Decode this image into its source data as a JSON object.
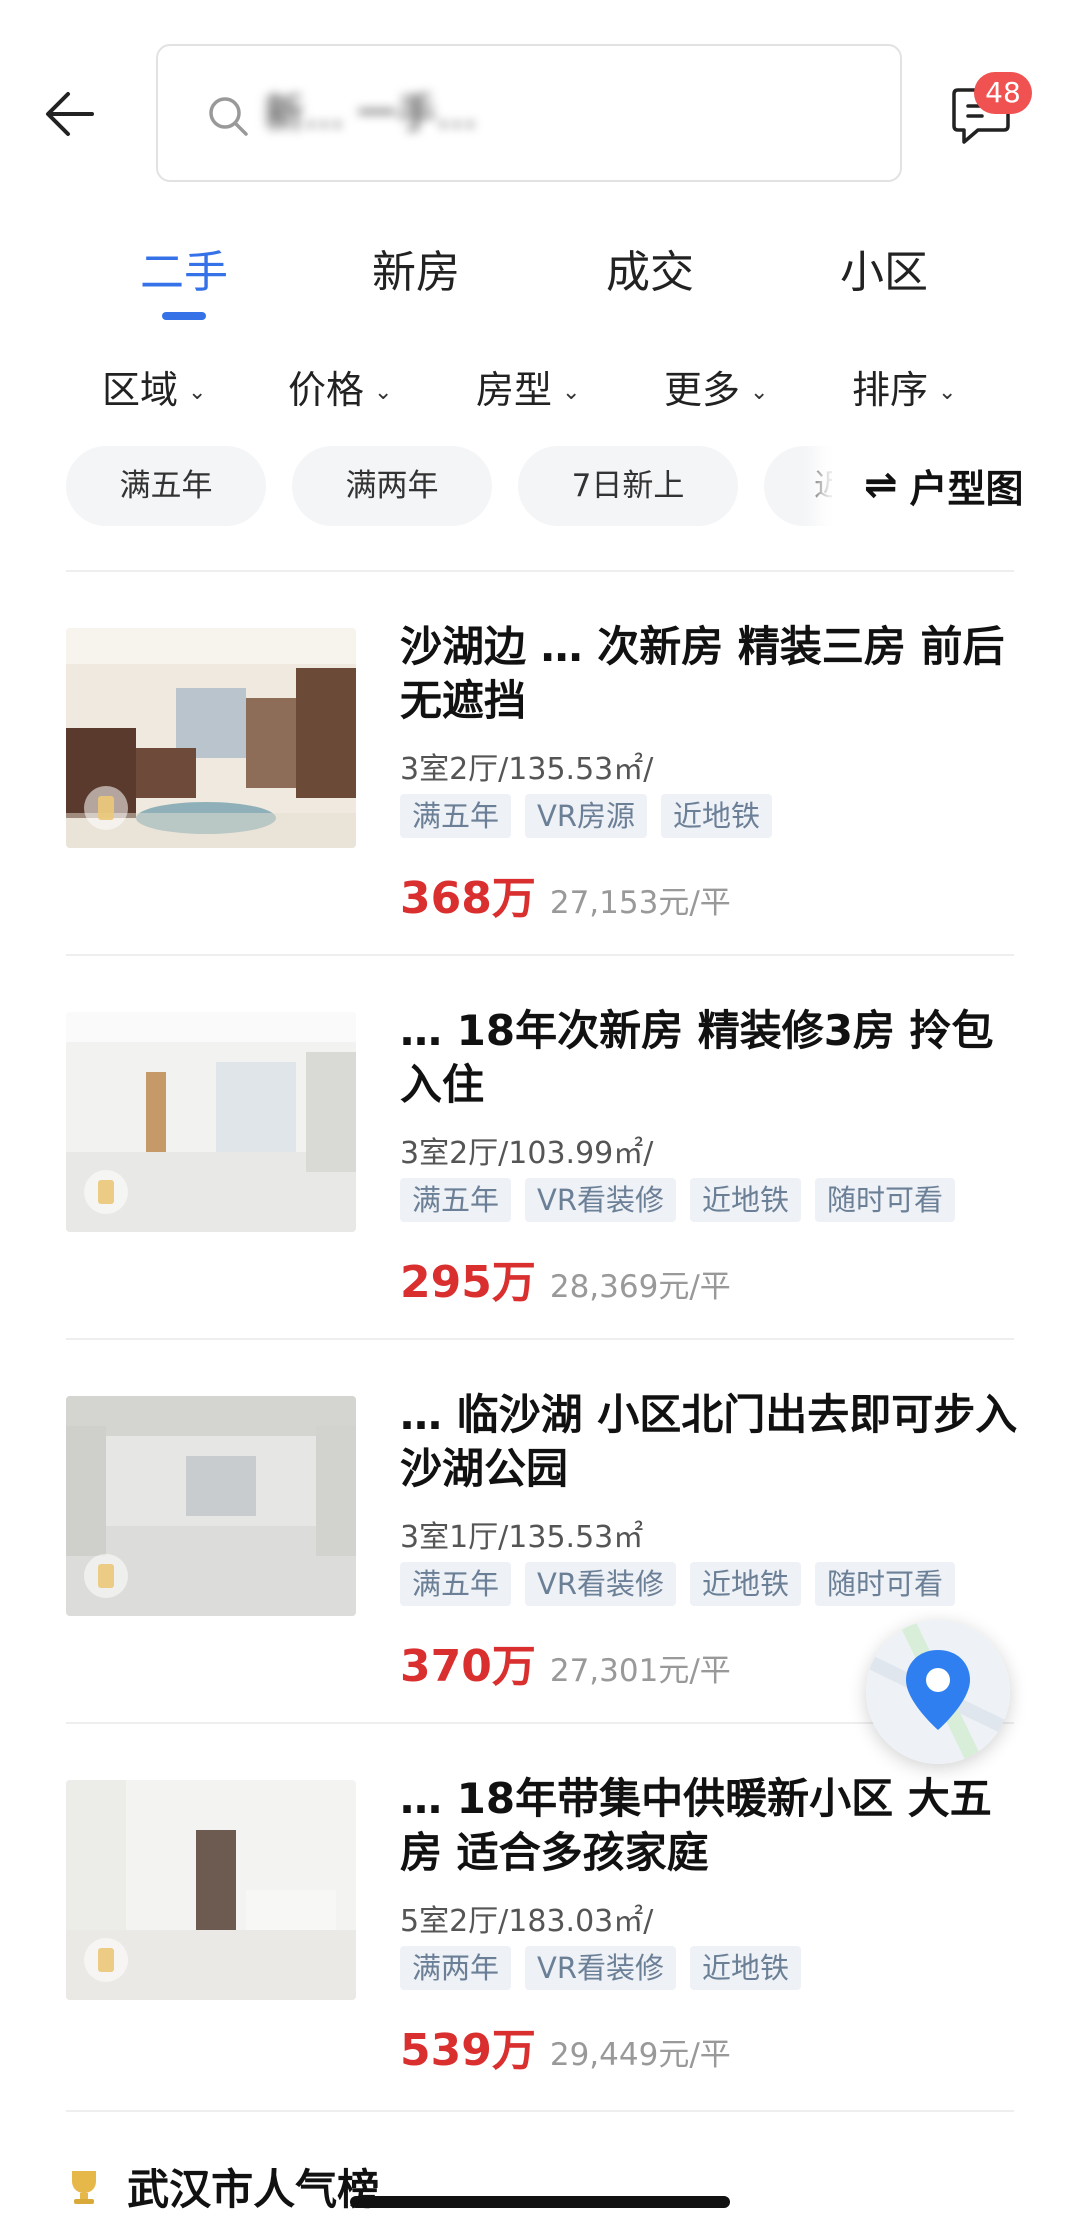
{
  "header": {
    "search_text": "新… 一手…",
    "message_badge": "48"
  },
  "tabs": [
    {
      "label": "二手",
      "active": true
    },
    {
      "label": "新房",
      "active": false
    },
    {
      "label": "成交",
      "active": false
    },
    {
      "label": "小区",
      "active": false
    }
  ],
  "filters": [
    {
      "label": "区域"
    },
    {
      "label": "价格"
    },
    {
      "label": "房型"
    },
    {
      "label": "更多"
    },
    {
      "label": "排序"
    }
  ],
  "chips": [
    {
      "label": "满五年"
    },
    {
      "label": "满两年"
    },
    {
      "label": "7日新上"
    },
    {
      "label": "近"
    }
  ],
  "layout_button": {
    "label": "户型图"
  },
  "listings": [
    {
      "title": "沙湖边 … 次新房 精装三房 前后无遮挡",
      "specs": "3室2厅/135.53㎡/",
      "tags": [
        "满五年",
        "VR房源",
        "近地铁"
      ],
      "price": "368万",
      "unit_price": "27,153元/平"
    },
    {
      "title": "… 18年次新房 精装修3房 拎包入住",
      "specs": "3室2厅/103.99㎡/",
      "tags": [
        "满五年",
        "VR看装修",
        "近地铁",
        "随时可看"
      ],
      "price": "295万",
      "unit_price": "28,369元/平"
    },
    {
      "title": "… 临沙湖 小区北门出去即可步入沙湖公园",
      "specs": "3室1厅/135.53㎡",
      "tags": [
        "满五年",
        "VR看装修",
        "近地铁",
        "随时可看"
      ],
      "price": "370万",
      "unit_price": "27,301元/平"
    },
    {
      "title": "… 18年带集中供暖新小区 大五房 适合多孩家庭",
      "specs": "5室2厅/183.03㎡/",
      "tags": [
        "满两年",
        "VR看装修",
        "近地铁"
      ],
      "price": "539万",
      "unit_price": "29,449元/平"
    }
  ],
  "popular": {
    "label": "武汉市人气榜"
  },
  "colors": {
    "accent": "#3572e8",
    "price_red": "#d92f2f",
    "badge_red": "#f05151",
    "tag_bg": "#eef1f5",
    "tag_text": "#6b7f97",
    "map_pin": "#2f7ff0"
  },
  "icons": {
    "back": "arrow-left-icon",
    "search": "search-icon",
    "message": "chat-icon",
    "layout": "swap-arrows-icon",
    "map": "map-pin-icon",
    "popular": "trophy-icon"
  }
}
